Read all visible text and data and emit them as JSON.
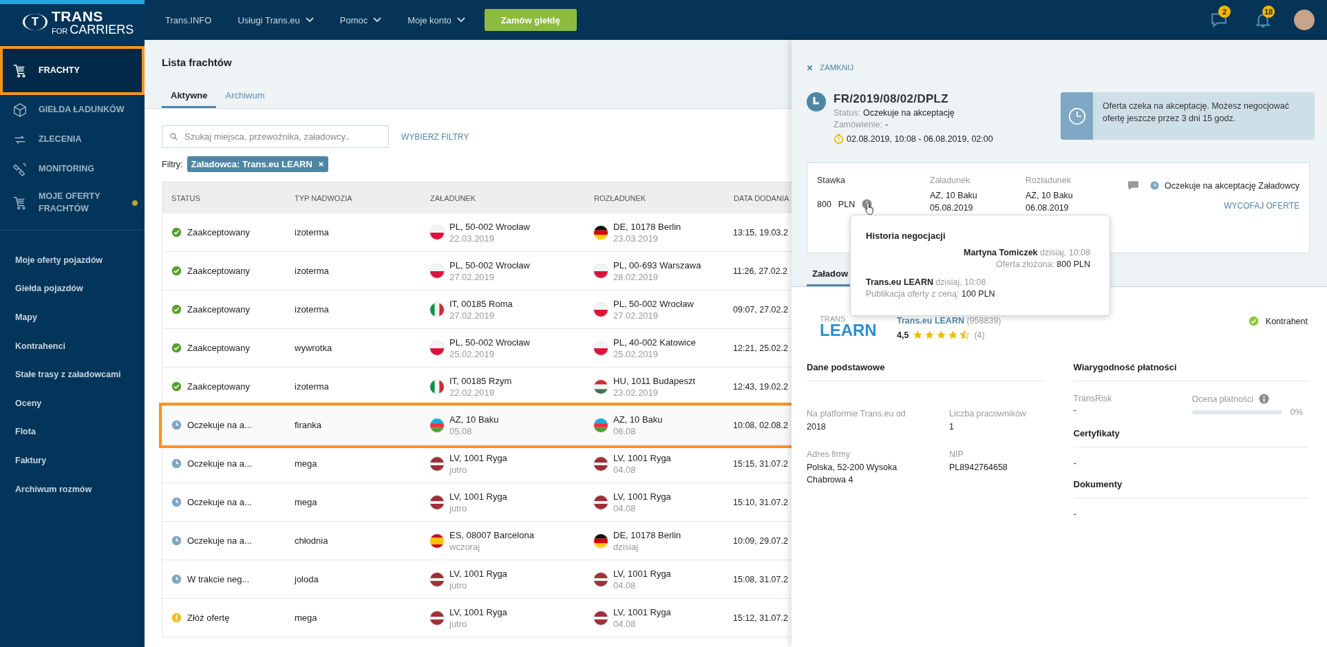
{
  "sidebar": {
    "logo": {
      "mark": "T",
      "name": "TRANS",
      "sub_1": "FOR",
      "sub_2": "CARRIERS"
    },
    "main_items": [
      {
        "label": "FRACHTY",
        "kind": "cart",
        "selected": true,
        "highlighted": true,
        "unread": false
      },
      {
        "label": "GIEŁDA ŁADUNKÓW",
        "kind": "box",
        "selected": false,
        "highlighted": false,
        "unread": false
      },
      {
        "label": "ZLECENIA",
        "kind": "arrows",
        "selected": false,
        "highlighted": false,
        "unread": false
      },
      {
        "label": "MONITORING",
        "kind": "satellite",
        "selected": false,
        "highlighted": false,
        "unread": false
      },
      {
        "label": "MOJE OFERTY FRACHTÓW",
        "kind": "cart",
        "selected": false,
        "highlighted": false,
        "unread": true
      }
    ],
    "links": [
      "Moje oferty pojazdów",
      "Giełda pojazdów",
      "Mapy",
      "Kontrahenci",
      "Stałe trasy z załadowcami",
      "Oceny",
      "Flota",
      "Faktury",
      "Archiwum rozmów"
    ]
  },
  "topbar": {
    "nav": [
      {
        "label": "Trans.INFO",
        "dropdown": false
      },
      {
        "label": "Usługi Trans.eu",
        "dropdown": true
      },
      {
        "label": "Pomoc",
        "dropdown": true
      },
      {
        "label": "Moje konto",
        "dropdown": true
      }
    ],
    "order_button": "Zamów giełdę",
    "messages_badge": "2",
    "notifications_badge": "18"
  },
  "page": {
    "title": "Lista frachtów",
    "tabs": [
      {
        "label": "Aktywne",
        "selected": true
      },
      {
        "label": "Archiwum",
        "selected": false
      }
    ],
    "search": {
      "placeholder": "Szukaj miejsca, przewoźnika, załadowcy.."
    },
    "filters_button": "WYBIERZ FILTRY",
    "filters_label": "Filtry:",
    "filter_chip": "Załadowca: Trans.eu LEARN",
    "table": {
      "columns": [
        "STATUS",
        "TYP NADWOZIA",
        "ZAŁADUNEK",
        "ROZŁADUNEK",
        "DATA DODANIA"
      ],
      "rows": [
        {
          "status": {
            "kind": "accepted",
            "text": "Zaakceptowany"
          },
          "body": "izoterma",
          "loading": {
            "kind": "pl",
            "place": "PL, 50-002 Wrocław",
            "date": "22.03.2019"
          },
          "unloading": {
            "kind": "de",
            "place": "DE, 10178 Berlin",
            "date": "23.03.2019"
          },
          "added": "13:15, 19.03.2",
          "highlighted": false
        },
        {
          "status": {
            "kind": "accepted",
            "text": "Zaakceptowany"
          },
          "body": "izoterma",
          "loading": {
            "kind": "pl",
            "place": "PL, 50-002 Wrocław",
            "date": "27.02.2019"
          },
          "unloading": {
            "kind": "pl",
            "place": "PL, 00-693 Warszawa",
            "date": "28.02.2019"
          },
          "added": "11:26, 27.02.2",
          "highlighted": false
        },
        {
          "status": {
            "kind": "accepted",
            "text": "Zaakceptowany"
          },
          "body": "izoterma",
          "loading": {
            "kind": "it",
            "place": "IT, 00185 Roma",
            "date": "27.02.2019"
          },
          "unloading": {
            "kind": "pl",
            "place": "PL, 50-002 Wrocław",
            "date": "27.02.2019"
          },
          "added": "09:07, 27.02.2",
          "highlighted": false
        },
        {
          "status": {
            "kind": "accepted",
            "text": "Zaakceptowany"
          },
          "body": "wywrotka",
          "loading": {
            "kind": "pl",
            "place": "PL, 50-002 Wrocław",
            "date": "25.02.2019"
          },
          "unloading": {
            "kind": "pl",
            "place": "PL, 40-002 Katowice",
            "date": "25.02.2019"
          },
          "added": "12:21, 25.02.2",
          "highlighted": false
        },
        {
          "status": {
            "kind": "accepted",
            "text": "Zaakceptowany"
          },
          "body": "izoterma",
          "loading": {
            "kind": "it",
            "place": "IT, 00185 Rzym",
            "date": "22.02.2019"
          },
          "unloading": {
            "kind": "hu",
            "place": "HU, 1011 Budapeszt",
            "date": "23.02.2019"
          },
          "added": "12:43, 19.02.2",
          "highlighted": false
        },
        {
          "status": {
            "kind": "pending",
            "text": "Oczekuje na a..."
          },
          "body": "firanka",
          "loading": {
            "kind": "az",
            "place": "AZ, 10 Baku",
            "date": "05.08"
          },
          "unloading": {
            "kind": "az",
            "place": "AZ, 10 Baku",
            "date": "06.08"
          },
          "added": "10:08, 02.08.2",
          "highlighted": true
        },
        {
          "status": {
            "kind": "pending",
            "text": "Oczekuje na a..."
          },
          "body": "mega",
          "loading": {
            "kind": "lv",
            "place": "LV, 1001 Ryga",
            "date": "jutro"
          },
          "unloading": {
            "kind": "lv",
            "place": "LV, 1001 Ryga",
            "date": "04.08"
          },
          "added": "15:15, 31.07.2",
          "highlighted": false
        },
        {
          "status": {
            "kind": "pending",
            "text": "Oczekuje na a..."
          },
          "body": "mega",
          "loading": {
            "kind": "lv",
            "place": "LV, 1001 Ryga",
            "date": "jutro"
          },
          "unloading": {
            "kind": "lv",
            "place": "LV, 1001 Ryga",
            "date": "04.08"
          },
          "added": "15:10, 31.07.2",
          "highlighted": false
        },
        {
          "status": {
            "kind": "pending",
            "text": "Oczekuje na a..."
          },
          "body": "chłodnia",
          "loading": {
            "kind": "es",
            "place": "ES, 08007 Barcelona",
            "date": "wczoraj"
          },
          "unloading": {
            "kind": "de",
            "place": "DE, 10178 Berlin",
            "date": "dzisiaj"
          },
          "added": "10:09, 29.07.2",
          "highlighted": false
        },
        {
          "status": {
            "kind": "pending",
            "text": "W trakcie neg..."
          },
          "body": "joloda",
          "loading": {
            "kind": "lv",
            "place": "LV, 1001 Ryga",
            "date": "jutro"
          },
          "unloading": {
            "kind": "lv",
            "place": "LV, 1001 Ryga",
            "date": "04.08"
          },
          "added": "15:08, 31.07.2",
          "highlighted": false
        },
        {
          "status": {
            "kind": "offer",
            "text": "Złóż ofertę"
          },
          "body": "mega",
          "loading": {
            "kind": "lv",
            "place": "LV, 1001 Ryga",
            "date": "jutro"
          },
          "unloading": {
            "kind": "lv",
            "place": "LV, 1001 Ryga",
            "date": "04.08"
          },
          "added": "15:12, 31.07.2",
          "highlighted": false
        }
      ]
    }
  },
  "panel": {
    "close": "ZAMKNIJ",
    "number": "FR/2019/08/02/DPLZ",
    "status_label": "Status:",
    "status": "Oczekuje na akceptację",
    "order_label": "Zamówienie:",
    "order": "-",
    "period": "02.08.2019, 10:08 - 06.08.2019, 02:00",
    "banner": "Oferta czeka na akceptację. Możesz negocjować ofertę jeszcze przez 3 dni 15 godz.",
    "offer": {
      "rate_label": "Stawka",
      "rate": "800",
      "currency": "PLN",
      "loading_label": "Załadunek",
      "loading_place": "AZ, 10 Baku",
      "loading_date": "05.08.2019",
      "unloading_label": "Rozładunek",
      "unloading_place": "AZ, 10 Baku",
      "unloading_date": "06.08.2019",
      "status": "Oczekuje na akceptację Załadowcy",
      "withdraw": "WYCOFAJ OFERTE"
    },
    "tabs": [
      {
        "label": "Załadow",
        "selected": true
      }
    ],
    "company": {
      "logo_top": "TRANS",
      "logo_main": "LEARN",
      "name": "Trans.eu LEARN",
      "id": "(958839)",
      "rating": "4,5",
      "stars": 4.5,
      "reviews": "(4)",
      "badge": "Kontrahent"
    },
    "basic": {
      "title": "Dane podstawowe",
      "fields": [
        {
          "label": "Na platformie Trans.eu od",
          "value": "2018"
        },
        {
          "label": "Liczba pracowników",
          "value": "1"
        },
        {
          "label": "Adres firmy",
          "value": "Polska, 52-200 Wysoka Chabrowa 4"
        },
        {
          "label": "NIP",
          "value": "PL8942764658"
        }
      ]
    },
    "payment": {
      "title": "Wiarygodność płatności",
      "transrisk_label": "TransRisk",
      "transrisk": "-",
      "score_label": "Ocena płatności",
      "level": 0,
      "percent": "0%"
    },
    "certificates": {
      "title": "Certyfikaty",
      "value": "-"
    },
    "documents": {
      "title": "Dokumenty",
      "value": "-"
    },
    "tooltip": {
      "title": "Historia negocjacji",
      "entries": [
        {
          "kind": "right",
          "author": "Martyna Tomiczek",
          "time": "dzisiaj, 10:08",
          "label": "Oferta złożona:",
          "value": "800 PLN"
        },
        {
          "kind": "left",
          "author": "Trans.eu LEARN",
          "time": "dzisiaj, 10:08",
          "label": "Publikacja oferty z ceną:",
          "value": "100 PLN"
        }
      ]
    }
  }
}
